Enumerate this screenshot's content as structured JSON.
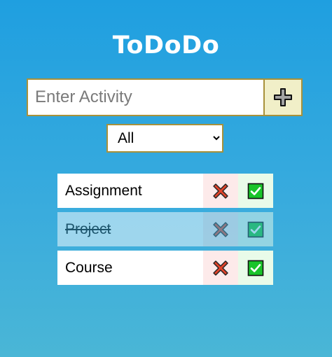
{
  "app": {
    "title": "ToDoDo"
  },
  "form": {
    "input_placeholder": "Enter Activity",
    "input_value": "",
    "add_icon": "plus-icon"
  },
  "filter": {
    "selected": "All",
    "options": [
      "All"
    ]
  },
  "todos": [
    {
      "text": "Assignment",
      "completed": false
    },
    {
      "text": "Project",
      "completed": true
    },
    {
      "text": "Course",
      "completed": false
    }
  ],
  "icons": {
    "delete": "cross-mark-icon",
    "complete": "check-mark-icon"
  },
  "colors": {
    "background_top": "#1f9fe0",
    "background_bottom": "#4ab6d6",
    "accent_border": "#a7913b",
    "add_button_bg": "#f1efc8",
    "delete_red": "#e0432b",
    "check_green": "#19c42a"
  }
}
